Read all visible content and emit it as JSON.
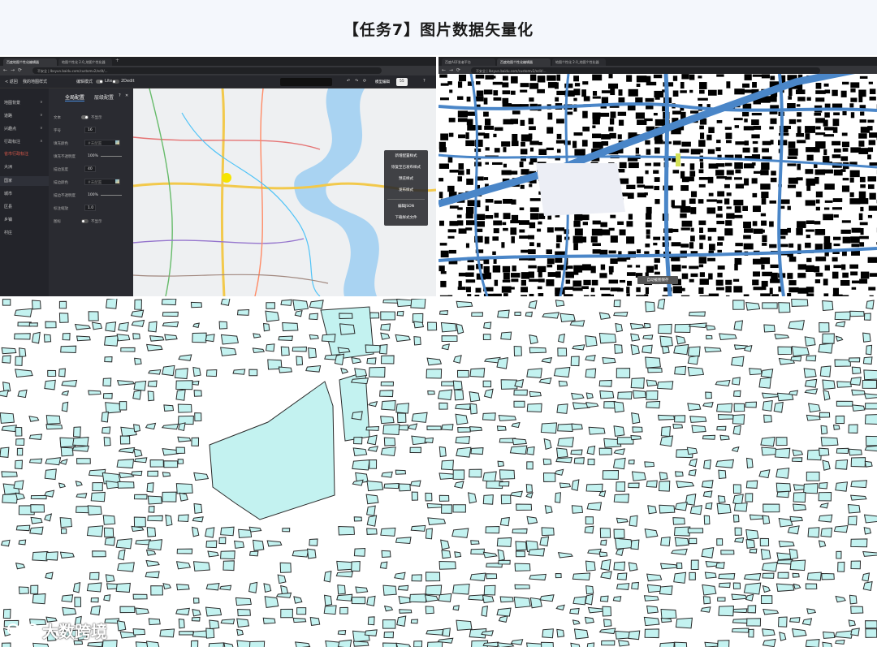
{
  "slide": {
    "title": "【任务7】图片数据矢量化"
  },
  "left_screenshot": {
    "tabs": [
      "百度地图个性化编辑器",
      "地图个性化 2.0_地图个性化器",
      "+"
    ],
    "address": "不安全 | lbsyun.baidu.com/customv2/edit/...",
    "editor": {
      "back": "< 返回",
      "style_name": "我的地图样式",
      "edit_mode": "编辑模式",
      "lite": "Lite",
      "mode_2d": "2Dedit",
      "tools": [
        "↶",
        "↷",
        "⟳"
      ],
      "btn_primary": "模型编辑",
      "btn_secondary": "55",
      "help": "?"
    },
    "layer_menu": [
      {
        "label": "地图背景",
        "chev": "∨"
      },
      {
        "label": "道路",
        "chev": "∨"
      },
      {
        "label": "兴趣点",
        "chev": "∨"
      },
      {
        "label": "行政标注",
        "chev": "∧"
      },
      {
        "label": "省市行政标注",
        "chev": "",
        "highlight": true
      },
      {
        "label": "大洲",
        "chev": ""
      },
      {
        "label": "国家",
        "chev": ""
      },
      {
        "label": "城市",
        "chev": ""
      },
      {
        "label": "区县",
        "chev": ""
      },
      {
        "label": "乡镇",
        "chev": ""
      },
      {
        "label": "村庄",
        "chev": ""
      }
    ],
    "config_tabs": [
      "全局配置",
      "层级配置"
    ],
    "config_rows": [
      {
        "label": "文本",
        "value": "不显示"
      },
      {
        "label": "字号",
        "value": "16"
      },
      {
        "label": "填充颜色",
        "value": "#未配置"
      },
      {
        "label": "填充不透明度",
        "value": "100%"
      },
      {
        "label": "描边宽度",
        "value": "40"
      },
      {
        "label": "描边颜色",
        "value": "#未配置"
      },
      {
        "label": "描边不透明度",
        "value": "100%"
      },
      {
        "label": "标注缩放",
        "value": "1.0"
      },
      {
        "label": "图标",
        "value": "不显示"
      }
    ],
    "style_menu": [
      "新增配置样式",
      "恢复至已发布样式",
      "预览样式",
      "发布样式",
      "编辑JSON",
      "下载样式文件"
    ]
  },
  "right_screenshot": {
    "tabs": [
      "百度AI开发者平台",
      "百度地图个性化编辑器",
      "地图个性化 2.0_地图个性化器"
    ],
    "address": "不安全 | lbsyun.baidu.com/customv2/edit/...",
    "fit_button": "自动截图保存"
  },
  "vector_map": {
    "fill_color": "#c3f2f0",
    "stroke_color": "#2a2a2a"
  },
  "watermark": {
    "text": "大数跨境"
  }
}
